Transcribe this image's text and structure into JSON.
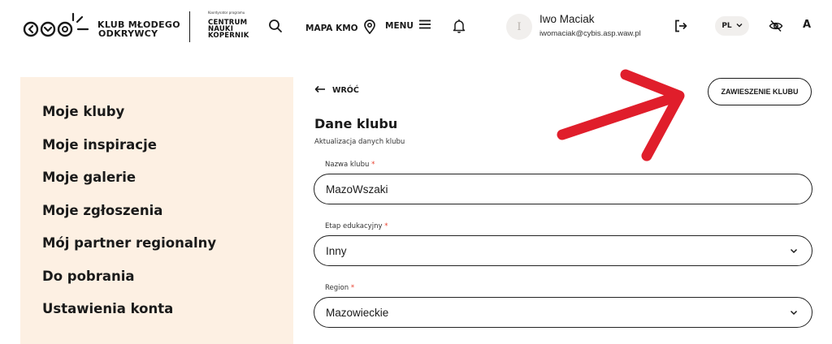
{
  "header": {
    "brand_line1": "KLUB MŁODEGO",
    "brand_line2": "ODKRYWCY",
    "partner_caption": "Koordynator programu",
    "partner_line1": "CENTRUM",
    "partner_line2": "NAUKI",
    "partner_line3": "KOPERNIK",
    "map_label": "MAPA KMO",
    "menu_label": "MENU",
    "avatar_initial": "I",
    "user_name": "Iwo Maciak",
    "user_email": "iwomaciak@cybis.asp.waw.pl",
    "lang": "PL",
    "font_size_label": "A",
    "icons": [
      "logo-circles",
      "search-icon",
      "map-pin-icon",
      "hamburger-icon",
      "bell-icon",
      "logout-icon",
      "chevron-down-icon",
      "eye-slash-icon"
    ]
  },
  "sidebar": {
    "items": [
      {
        "label": "Moje kluby"
      },
      {
        "label": "Moje inspiracje"
      },
      {
        "label": "Moje galerie"
      },
      {
        "label": "Moje zgłoszenia"
      },
      {
        "label": "Mój partner regionalny"
      },
      {
        "label": "Do pobrania"
      },
      {
        "label": "Ustawienia konta"
      }
    ]
  },
  "main": {
    "back_label": "WRÓĆ",
    "suspend_label": "ZAWIESZENIE KLUBU",
    "title": "Dane klubu",
    "subtitle": "Aktualizacja danych klubu",
    "required_mark": "*",
    "fields": [
      {
        "label": "Nazwa klubu",
        "value": "MazoWszaki",
        "type": "text"
      },
      {
        "label": "Etap edukacyjny",
        "value": "Inny",
        "type": "select"
      },
      {
        "label": "Region",
        "value": "Mazowieckie",
        "type": "select"
      }
    ]
  },
  "colors": {
    "sidebar_bg": "#fdf0e3",
    "required": "#e8402e",
    "annotation_arrow": "#e01e2b"
  }
}
